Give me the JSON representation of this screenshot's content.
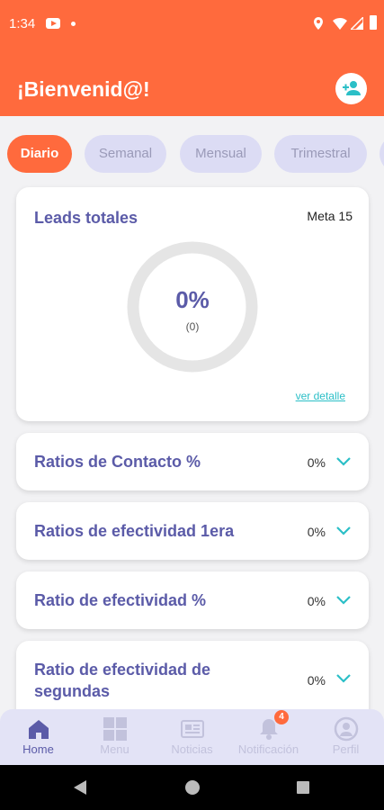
{
  "status_bar": {
    "time": "1:34"
  },
  "header": {
    "title": "¡Bienvenid@!"
  },
  "tabs": [
    {
      "label": "Diario",
      "active": true
    },
    {
      "label": "Semanal",
      "active": false
    },
    {
      "label": "Mensual",
      "active": false
    },
    {
      "label": "Trimestral",
      "active": false
    }
  ],
  "leads": {
    "title": "Leads totales",
    "meta": "Meta 15",
    "percent": "0%",
    "count": "(0)",
    "progress": 0,
    "detail_link": "ver detalle"
  },
  "ratios": [
    {
      "label": "Ratios de Contacto %",
      "value": "0%"
    },
    {
      "label": "Ratios de efectividad 1era",
      "value": "0%"
    },
    {
      "label": "Ratio de efectividad %",
      "value": "0%"
    },
    {
      "label": "Ratio de efectividad de segundas",
      "value": "0%"
    }
  ],
  "bottom_nav": [
    {
      "label": "Home",
      "icon": "home-icon",
      "active": true
    },
    {
      "label": "Menu",
      "icon": "grid-icon",
      "active": false
    },
    {
      "label": "Noticias",
      "icon": "newspaper-icon",
      "active": false
    },
    {
      "label": "Notificación",
      "icon": "bell-icon",
      "active": false,
      "badge": "4"
    },
    {
      "label": "Perfil",
      "icon": "user-icon",
      "active": false
    }
  ],
  "colors": {
    "accent": "#ff6a3d",
    "primary_text": "#5b5ba8",
    "teal": "#2bbfc7",
    "tab_bg": "#dcdcf4",
    "nav_bg": "#e3e3f6"
  }
}
